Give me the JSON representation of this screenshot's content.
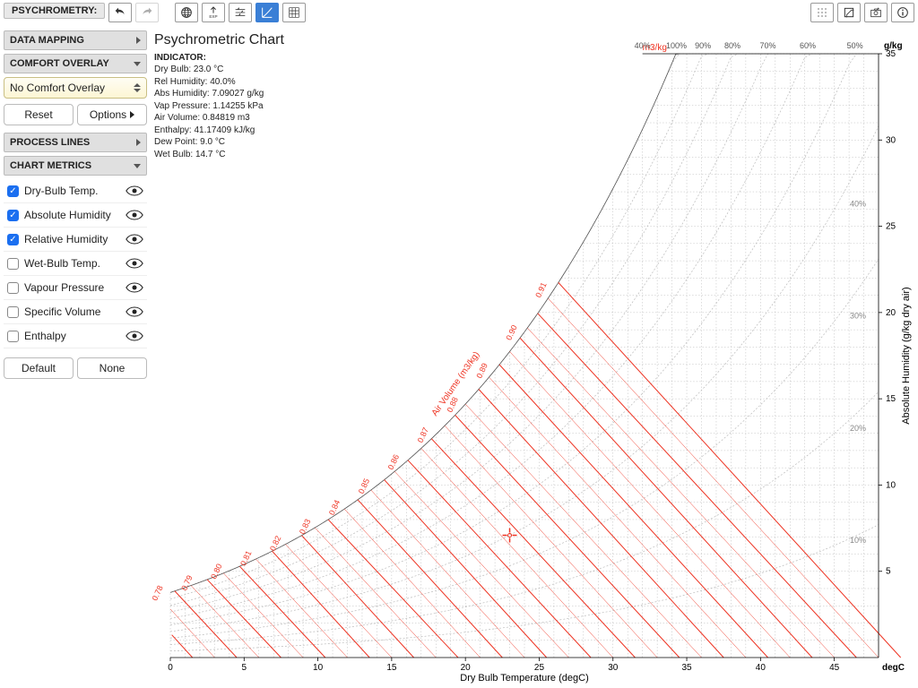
{
  "toolbar": {
    "title": "PSYCHROMETRY:"
  },
  "sidebar": {
    "data_mapping": "DATA MAPPING",
    "comfort_overlay": "COMFORT OVERLAY",
    "overlay_select": "No Comfort Overlay",
    "reset": "Reset",
    "options": "Options",
    "process_lines": "PROCESS LINES",
    "chart_metrics": "CHART METRICS",
    "metrics": [
      {
        "label": "Dry-Bulb Temp.",
        "checked": true
      },
      {
        "label": "Absolute Humidity",
        "checked": true
      },
      {
        "label": "Relative Humidity",
        "checked": true
      },
      {
        "label": "Wet-Bulb Temp.",
        "checked": false
      },
      {
        "label": "Vapour Pressure",
        "checked": false
      },
      {
        "label": "Specific Volume",
        "checked": false
      },
      {
        "label": "Enthalpy",
        "checked": false
      }
    ],
    "default": "Default",
    "none": "None"
  },
  "info": {
    "title": "Psychrometric Chart",
    "heading": "INDICATOR:",
    "lines": [
      "Dry Bulb: 23.0 °C",
      "Rel Humidity: 40.0%",
      "Abs Humidity: 7.09027 g/kg",
      "Vap Pressure: 1.14255 kPa",
      "Air Volume: 0.84819 m3",
      "Enthalpy: 41.17409 kJ/kg",
      "Dew Point: 9.0 °C",
      "Wet Bulb: 14.7 °C"
    ]
  },
  "chart_data": {
    "type": "other",
    "title": "Psychrometric Chart",
    "xlabel": "Dry Bulb Temperature (degC)",
    "ylabel": "Absolute Humidity (g/kg dry air)",
    "x_unit": "degC",
    "y_unit": "g/kg",
    "x_ticks": [
      0,
      5,
      10,
      15,
      20,
      25,
      30,
      35,
      40,
      45
    ],
    "y_ticks": [
      5,
      10,
      15,
      20,
      25,
      30,
      35
    ],
    "rh_labels": [
      "100%",
      "90%",
      "80%",
      "70%",
      "60%",
      "50%",
      "40%"
    ],
    "rh_side_labels": [
      "10%",
      "20%",
      "30%",
      "40%"
    ],
    "vol_label": "Air Volume (m3/kg)",
    "vol_unit": "m3/kg",
    "vol_lines": [
      0.78,
      0.79,
      0.8,
      0.81,
      0.82,
      0.83,
      0.84,
      0.85,
      0.86,
      0.87,
      0.88,
      0.89,
      0.9,
      0.91
    ],
    "indicator": {
      "dry_bulb": 23.0,
      "rel_humidity": 40.0,
      "abs_humidity": 7.09
    }
  }
}
